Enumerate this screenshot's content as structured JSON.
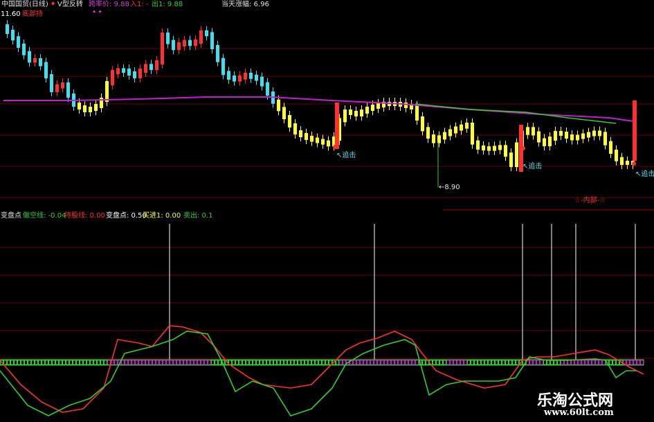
{
  "colors": {
    "background": "#000000",
    "up": "#ff3030",
    "down": "#40e0f0",
    "yellow": "#ffff30",
    "magenta": "#c020d0",
    "green": "#30d030",
    "grid": "#6a0000",
    "white": "#ffffff"
  },
  "top_header": {
    "stock": "中国国贸(日线)",
    "indicator_name": "V型反转",
    "rate_label": "跨率价: 9.88",
    "in_label": "入1: -",
    "out_label": "出1: 9.88",
    "day_change": "当天涨幅: 6.96",
    "line2_value": "11.60",
    "line2_label": "底部持"
  },
  "annotations": {
    "low_price": "8.90",
    "chase_label": "追击",
    "bottom_tag": "☆-内部-☆"
  },
  "bottom_header": {
    "name": "变盘点",
    "bear_label": "做空线: -0.04",
    "bull_label": "持股线: 0.00",
    "turn_label": "变盘点: 0.50",
    "buy_label": "买进1: 0.00",
    "sell_label": "卖出: 0.1"
  },
  "watermark": {
    "title": "乐淘公式网",
    "url": "www.60lt.com"
  }
}
